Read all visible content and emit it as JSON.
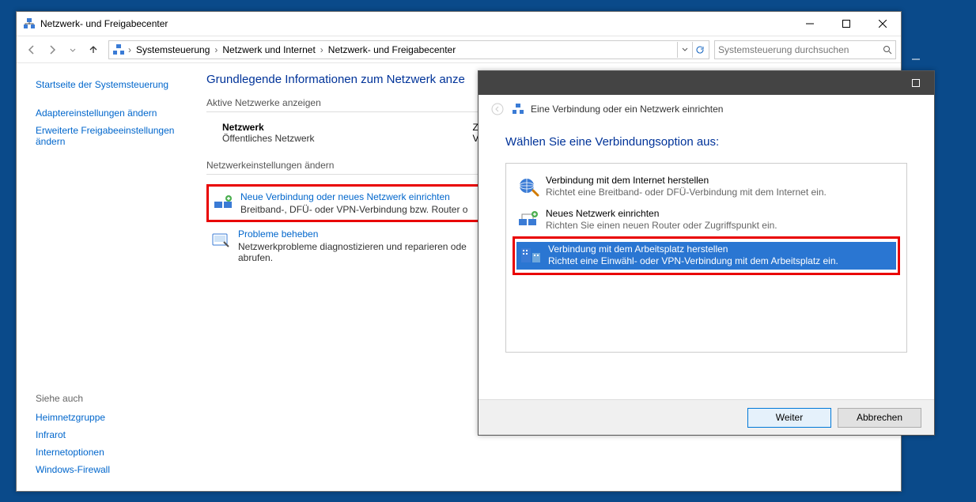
{
  "main_window": {
    "title": "Netzwerk- und Freigabecenter",
    "breadcrumbs": [
      "Systemsteuerung",
      "Netzwerk und Internet",
      "Netzwerk- und Freigabecenter"
    ],
    "search_placeholder": "Systemsteuerung durchsuchen",
    "sidebar": {
      "top": [
        "Startseite der Systemsteuerung",
        "Adaptereinstellungen ändern",
        "Erweiterte Freigabeeinstellungen ändern"
      ],
      "section_label": "Siehe auch",
      "bottom": [
        "Heimnetzgruppe",
        "Infrarot",
        "Internetoptionen",
        "Windows-Firewall"
      ]
    },
    "heading": "Grundlegende Informationen zum Netzwerk anze",
    "active_section_label": "Aktive Netzwerke anzeigen",
    "network": {
      "name": "Netzwerk",
      "type": "Öffentliches Netzwerk",
      "right1_label": "Zugr",
      "right2_label": "Verb"
    },
    "change_section_label": "Netzwerkeinstellungen ändern",
    "tasks": [
      {
        "icon": "new-connection-icon",
        "title": "Neue Verbindung oder neues Netzwerk einrichten",
        "desc": "Breitband-, DFÜ- oder VPN-Verbindung bzw. Router o",
        "highlighted": true
      },
      {
        "icon": "troubleshoot-icon",
        "title": "Probleme beheben",
        "desc": "Netzwerkprobleme diagnostizieren und reparieren ode\nabrufen.",
        "highlighted": false
      }
    ]
  },
  "wizard": {
    "subtitle": "Eine Verbindung oder ein Netzwerk einrichten",
    "heading": "Wählen Sie eine Verbindungsoption aus:",
    "options": [
      {
        "icon": "globe-icon",
        "title": "Verbindung mit dem Internet herstellen",
        "desc": "Richtet eine Breitband- oder DFÜ-Verbindung mit dem Internet ein.",
        "selected": false
      },
      {
        "icon": "router-icon",
        "title": "Neues Netzwerk einrichten",
        "desc": "Richten Sie einen neuen Router oder Zugriffspunkt ein.",
        "selected": false
      },
      {
        "icon": "workplace-icon",
        "title": "Verbindung mit dem Arbeitsplatz herstellen",
        "desc": "Richtet eine Einwähl- oder VPN-Verbindung mit dem Arbeitsplatz ein.",
        "selected": true
      }
    ],
    "buttons": {
      "next": "Weiter",
      "cancel": "Abbrechen"
    }
  }
}
